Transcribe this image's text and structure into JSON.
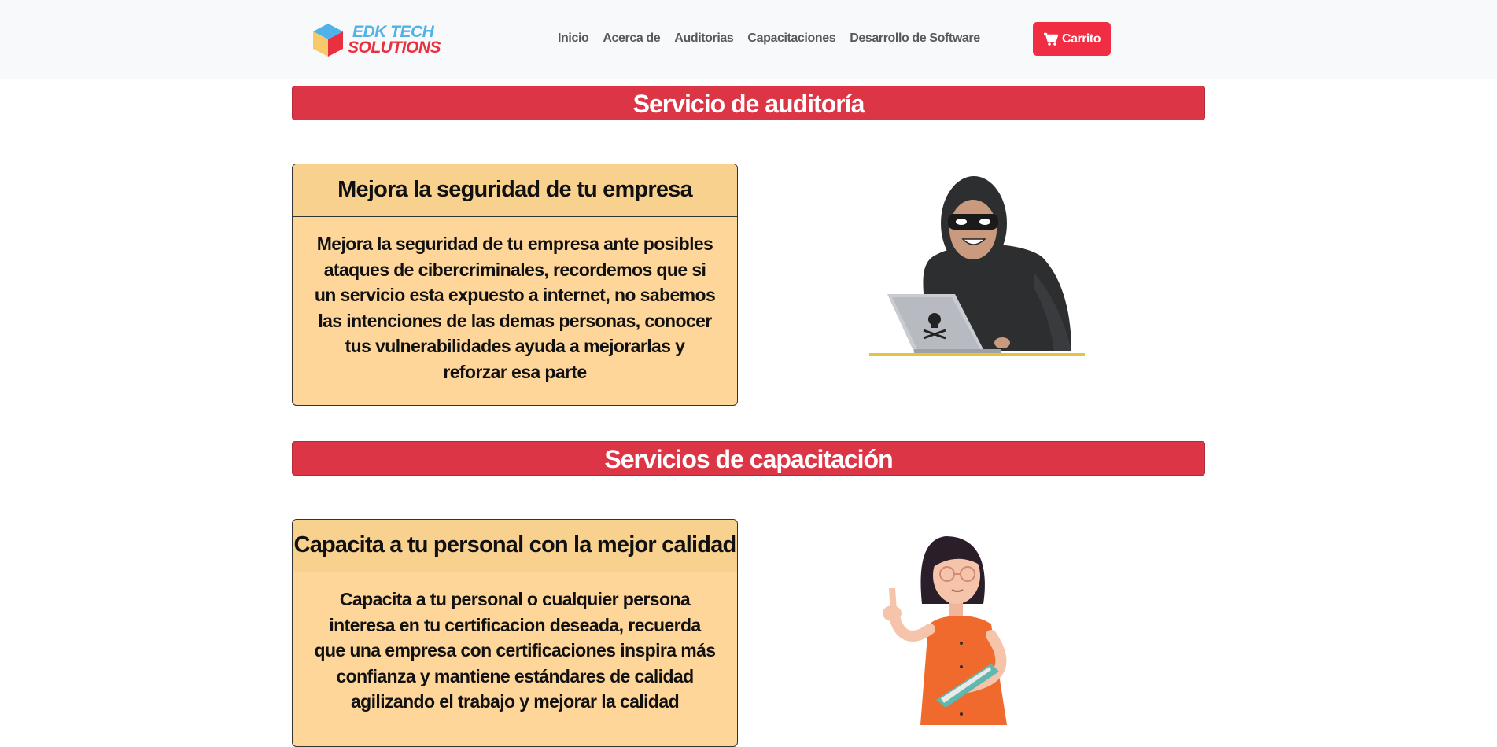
{
  "brand": {
    "line1": "EDK TECH",
    "line2": "SOLUTIONS"
  },
  "nav": {
    "links": [
      "Inicio",
      "Acerca de",
      "Auditorias",
      "Capacitaciones",
      "Desarrollo de Software"
    ],
    "cart_label": "Carrito"
  },
  "sections": [
    {
      "title": "Servicio de auditoría",
      "card_title": "Mejora la seguridad de tu empresa",
      "card_body": "Mejora la seguridad de tu empresa ante posibles ataques de cibercriminales, recordemos que si un servicio esta expuesto a internet, no sabemos las intenciones de las demas personas, conocer tus vulnerabilidades ayuda a mejorarlas y reforzar esa parte",
      "illustration": "hacker-illustration"
    },
    {
      "title": "Servicios de capacitación",
      "card_title": "Capacita a tu personal con la mejor calidad",
      "card_body": "Capacita a tu personal o cualquier persona interesa en tu certificacion deseada, recuerda que una empresa con certificaciones inspira más confianza y mantiene estándares de calidad agilizando el trabajo y mejorar la calidad",
      "illustration": "teacher-illustration"
    }
  ],
  "colors": {
    "accent": "#dc3545",
    "card": "#ffd699",
    "card_header": "#f9d18e",
    "navbar": "#f8f9fa"
  }
}
